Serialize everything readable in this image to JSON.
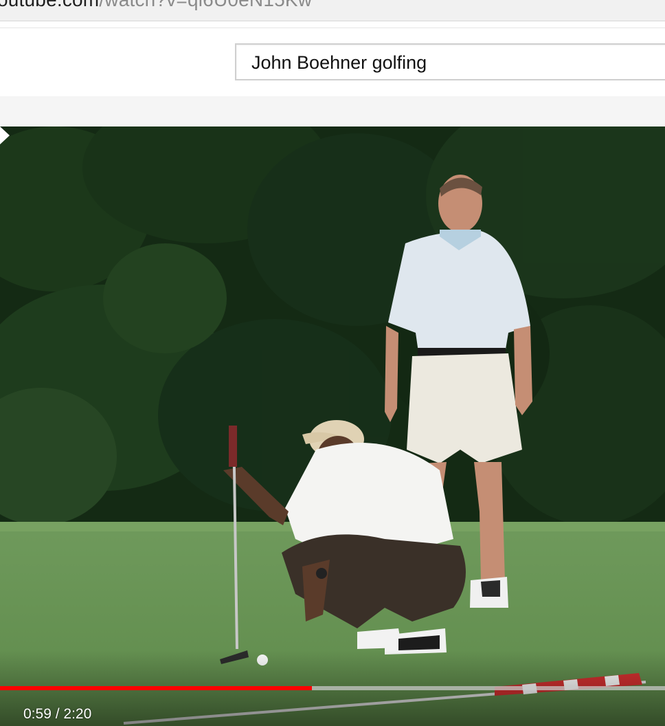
{
  "browser": {
    "url_host": "outube.com",
    "url_path": "/watch?v=qi6U0eN15Kw"
  },
  "masthead": {
    "search_value": "John Boehner golfing"
  },
  "player": {
    "scene_description_icon": "video-frame",
    "current_time": "0:59",
    "duration": "2:20",
    "time_separator": " / ",
    "progress_fraction": 0.469,
    "accent_color": "#ff0000"
  }
}
